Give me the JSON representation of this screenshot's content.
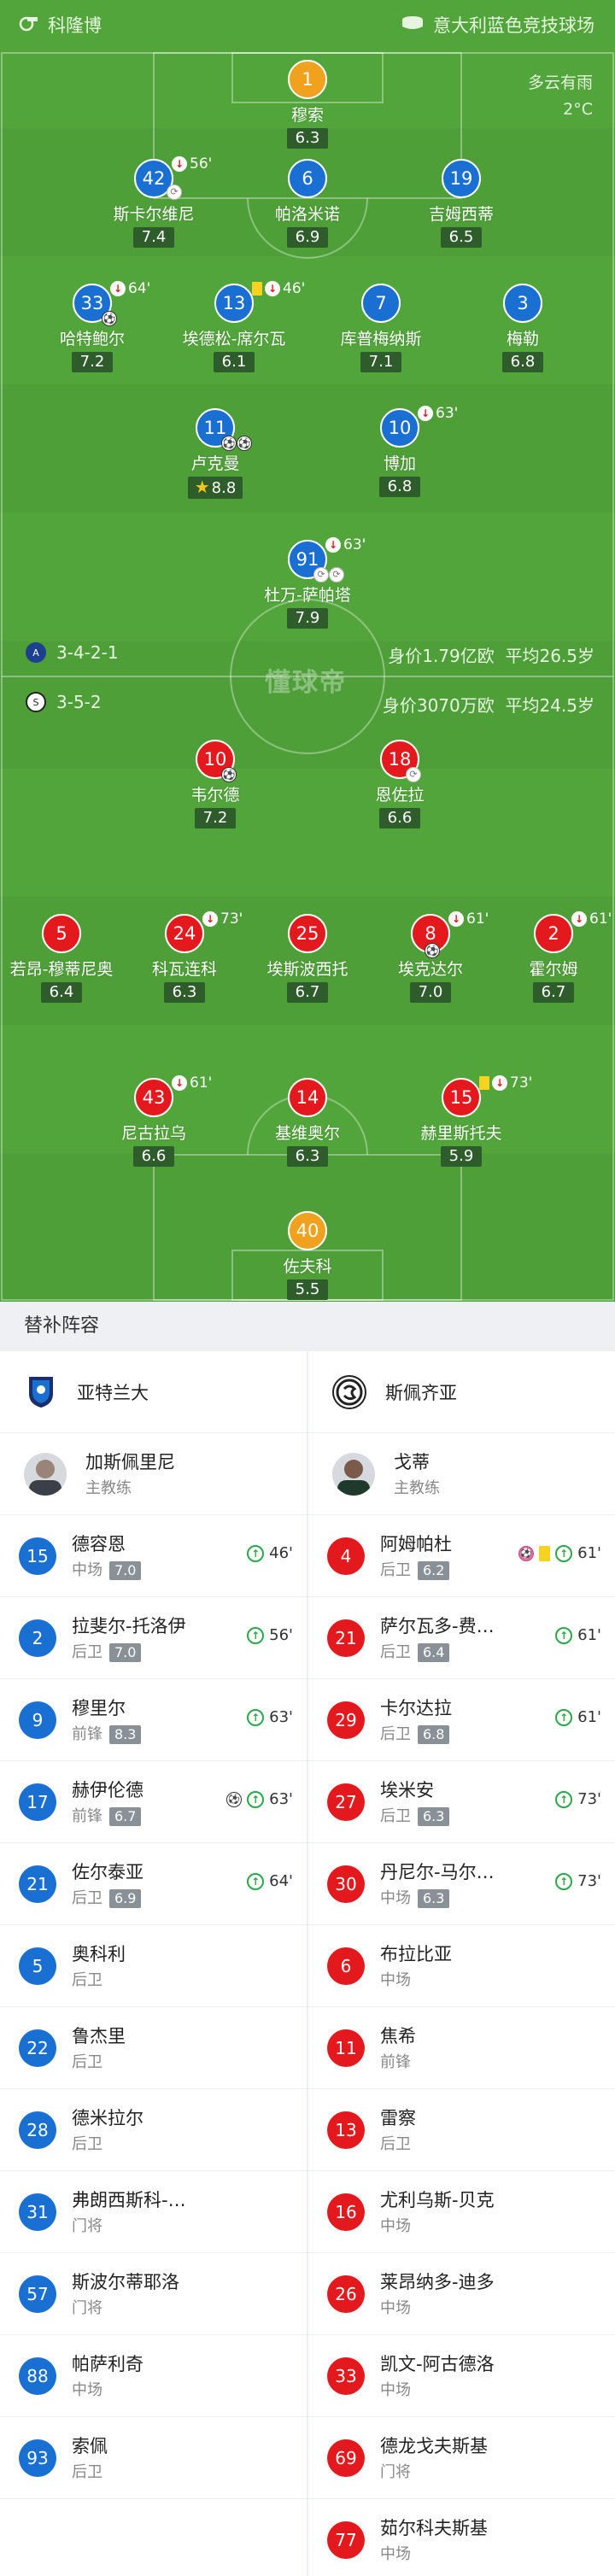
{
  "header": {
    "home_name": "科隆博",
    "venue": "意大利蓝色竞技球场"
  },
  "weather": {
    "condition": "多云有雨",
    "temp": "2°C"
  },
  "atalanta": {
    "formation": "3-4-2-1",
    "value": "身价1.79亿欧",
    "age": "平均26.5岁"
  },
  "spezia": {
    "formation": "3-5-2",
    "value": "身价3070万欧",
    "age": "平均24.5岁"
  },
  "watermark": "懂球帝",
  "pitch_players": [
    {
      "num": "1",
      "name": "穆索",
      "rating": "6.3",
      "color": "gold"
    },
    {
      "num": "42",
      "name": "斯卡尔维尼",
      "rating": "7.4",
      "color": "blue",
      "sub": "56'"
    },
    {
      "num": "6",
      "name": "帕洛米诺",
      "rating": "6.9",
      "color": "blue"
    },
    {
      "num": "19",
      "name": "吉姆西蒂",
      "rating": "6.5",
      "color": "blue"
    },
    {
      "num": "33",
      "name": "哈特鲍尔",
      "rating": "7.2",
      "color": "blue",
      "sub": "64'"
    },
    {
      "num": "13",
      "name": "埃德松-席尔瓦",
      "rating": "6.1",
      "color": "blue",
      "sub": "46'"
    },
    {
      "num": "7",
      "name": "库普梅纳斯",
      "rating": "7.1",
      "color": "blue"
    },
    {
      "num": "3",
      "name": "梅勒",
      "rating": "6.8",
      "color": "blue"
    },
    {
      "num": "11",
      "name": "卢克曼",
      "rating": "8.8",
      "color": "blue"
    },
    {
      "num": "10",
      "name": "博加",
      "rating": "6.8",
      "color": "blue",
      "sub": "63'"
    },
    {
      "num": "91",
      "name": "杜万-萨帕塔",
      "rating": "7.9",
      "color": "blue",
      "sub": "63'"
    },
    {
      "num": "10",
      "name": "韦尔德",
      "rating": "7.2",
      "color": "red"
    },
    {
      "num": "18",
      "name": "恩佐拉",
      "rating": "6.6",
      "color": "red"
    },
    {
      "num": "5",
      "name": "若昂-穆蒂尼奥",
      "rating": "6.4",
      "color": "red"
    },
    {
      "num": "24",
      "name": "科瓦连科",
      "rating": "6.3",
      "color": "red",
      "sub": "73'"
    },
    {
      "num": "25",
      "name": "埃斯波西托",
      "rating": "6.7",
      "color": "red"
    },
    {
      "num": "8",
      "name": "埃克达尔",
      "rating": "7.0",
      "color": "red",
      "sub": "61'"
    },
    {
      "num": "2",
      "name": "霍尔姆",
      "rating": "6.7",
      "color": "red",
      "sub": "61'"
    },
    {
      "num": "43",
      "name": "尼古拉乌",
      "rating": "6.6",
      "color": "red",
      "sub": "61'"
    },
    {
      "num": "14",
      "name": "基维奥尔",
      "rating": "6.3",
      "color": "red"
    },
    {
      "num": "15",
      "name": "赫里斯托夫",
      "rating": "5.9",
      "color": "red",
      "sub": "73'"
    },
    {
      "num": "40",
      "name": "佐夫科",
      "rating": "5.5",
      "color": "gold"
    }
  ],
  "subs": {
    "title": "替补阵容",
    "left_team": "亚特兰大",
    "right_team": "斯佩齐亚",
    "left_coach": {
      "name": "加斯佩里尼",
      "role": "主教练"
    },
    "right_coach": {
      "name": "戈蒂",
      "role": "主教练"
    },
    "left": [
      {
        "num": "15",
        "name": "德容恩",
        "pos": "中场",
        "rating": "7.0",
        "min": "46'"
      },
      {
        "num": "2",
        "name": "拉斐尔-托洛伊",
        "pos": "后卫",
        "rating": "7.0",
        "min": "56'"
      },
      {
        "num": "9",
        "name": "穆里尔",
        "pos": "前锋",
        "rating": "8.3",
        "min": "63'"
      },
      {
        "num": "17",
        "name": "赫伊伦德",
        "pos": "前锋",
        "rating": "6.7",
        "min": "63'"
      },
      {
        "num": "21",
        "name": "佐尔泰亚",
        "pos": "后卫",
        "rating": "6.9",
        "min": "64'"
      },
      {
        "num": "5",
        "name": "奥科利",
        "pos": "后卫"
      },
      {
        "num": "22",
        "name": "鲁杰里",
        "pos": "后卫"
      },
      {
        "num": "28",
        "name": "德米拉尔",
        "pos": "后卫"
      },
      {
        "num": "31",
        "name": "弗朗西斯科-…",
        "pos": "门将"
      },
      {
        "num": "57",
        "name": "斯波尔蒂耶洛",
        "pos": "门将"
      },
      {
        "num": "88",
        "name": "帕萨利奇",
        "pos": "中场"
      },
      {
        "num": "93",
        "name": "索佩",
        "pos": "后卫"
      }
    ],
    "right": [
      {
        "num": "4",
        "name": "阿姆帕杜",
        "pos": "后卫",
        "rating": "6.2",
        "min": "61'"
      },
      {
        "num": "21",
        "name": "萨尔瓦多-费…",
        "pos": "后卫",
        "rating": "6.4",
        "min": "61'"
      },
      {
        "num": "29",
        "name": "卡尔达拉",
        "pos": "后卫",
        "rating": "6.8",
        "min": "61'"
      },
      {
        "num": "27",
        "name": "埃米安",
        "pos": "后卫",
        "rating": "6.3",
        "min": "73'"
      },
      {
        "num": "30",
        "name": "丹尼尔-马尔…",
        "pos": "中场",
        "rating": "6.3",
        "min": "73'"
      },
      {
        "num": "6",
        "name": "布拉比亚",
        "pos": "中场"
      },
      {
        "num": "11",
        "name": "焦希",
        "pos": "前锋"
      },
      {
        "num": "13",
        "name": "雷察",
        "pos": "后卫"
      },
      {
        "num": "16",
        "name": "尤利乌斯-贝克",
        "pos": "中场"
      },
      {
        "num": "26",
        "name": "莱昂纳多-迪多",
        "pos": "中场"
      },
      {
        "num": "33",
        "name": "凯文-阿古德洛",
        "pos": "中场"
      },
      {
        "num": "69",
        "name": "德龙戈夫斯基",
        "pos": "门将"
      },
      {
        "num": "77",
        "name": "茹尔科夫斯基",
        "pos": "中场"
      }
    ]
  },
  "colors": {
    "pitch": "#52a53b",
    "blue": "#1a6fd2",
    "red": "#e3191e",
    "gold": "#f0a21e"
  }
}
